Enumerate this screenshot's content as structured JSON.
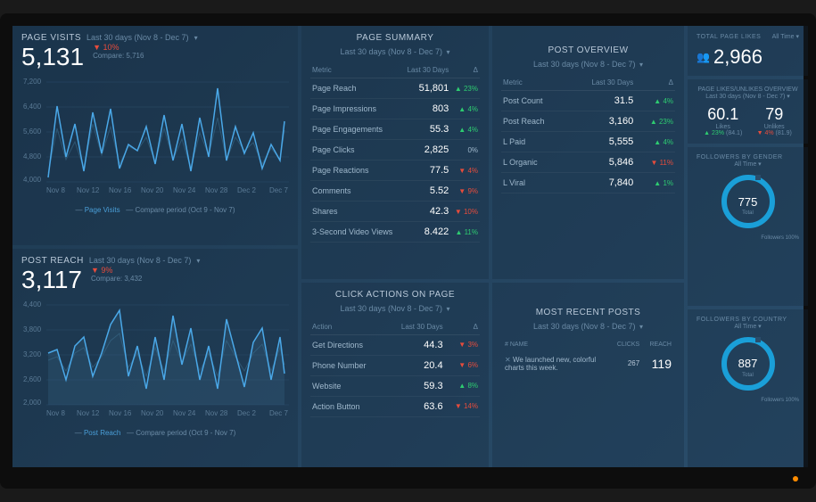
{
  "date_range_label": "Last 30 days (Nov 8 - Dec 7)",
  "compare_period": "Compare period (Oct 9 - Nov 7)",
  "page_visits": {
    "title": "PAGE VISITS",
    "value": "5,131",
    "delta": "10%",
    "compare": "Compare: 5,716",
    "legend": "Page Visits"
  },
  "post_reach": {
    "title": "POST REACH",
    "value": "3,117",
    "delta": "9%",
    "compare": "Compare: 3,432",
    "legend": "Post Reach"
  },
  "page_summary": {
    "title": "PAGE SUMMARY",
    "head_metric": "Metric",
    "head_val": "Last 30 Days",
    "head_delta": "Δ",
    "rows": [
      {
        "m": "Page Reach",
        "v": "51,801",
        "d": "▲ 23%",
        "c": "up"
      },
      {
        "m": "Page Impressions",
        "v": "803",
        "d": "▲ 4%",
        "c": "up"
      },
      {
        "m": "Page Engagements",
        "v": "55.3",
        "d": "▲ 4%",
        "c": "up"
      },
      {
        "m": "Page Clicks",
        "v": "2,825",
        "d": "0%",
        "c": ""
      },
      {
        "m": "Page Reactions",
        "v": "77.5",
        "d": "▼ 4%",
        "c": "down"
      },
      {
        "m": "Comments",
        "v": "5.52",
        "d": "▼ 9%",
        "c": "down"
      },
      {
        "m": "Shares",
        "v": "42.3",
        "d": "▼ 10%",
        "c": "down"
      },
      {
        "m": "3-Second Video Views",
        "v": "8.422",
        "d": "▲ 11%",
        "c": "up"
      }
    ]
  },
  "click_actions": {
    "title": "CLICK ACTIONS ON PAGE",
    "head_action": "Action",
    "head_val": "Last 30 Days",
    "head_delta": "Δ",
    "rows": [
      {
        "m": "Get Directions",
        "v": "44.3",
        "d": "▼ 3%",
        "c": "down"
      },
      {
        "m": "Phone Number",
        "v": "20.4",
        "d": "▼ 6%",
        "c": "down"
      },
      {
        "m": "Website",
        "v": "59.3",
        "d": "▲ 8%",
        "c": "up"
      },
      {
        "m": "Action Button",
        "v": "63.6",
        "d": "▼ 14%",
        "c": "down"
      }
    ]
  },
  "post_overview": {
    "title": "POST OVERVIEW",
    "head_metric": "Metric",
    "head_val": "Last 30 Days",
    "head_delta": "Δ",
    "rows": [
      {
        "m": "Post Count",
        "v": "31.5",
        "d": "▲ 4%",
        "c": "up"
      },
      {
        "m": "Post Reach",
        "v": "3,160",
        "d": "▲ 23%",
        "c": "up"
      },
      {
        "m": "L Paid",
        "v": "5,555",
        "d": "▲ 4%",
        "c": "up"
      },
      {
        "m": "L Organic",
        "v": "5,846",
        "d": "▼ 11%",
        "c": "down"
      },
      {
        "m": "L Viral",
        "v": "7,840",
        "d": "▲ 1%",
        "c": "up"
      }
    ]
  },
  "recent_posts": {
    "title": "MOST RECENT POSTS",
    "head_name": "NAME",
    "head_clicks": "CLICKS",
    "head_reach": "REACH",
    "row": {
      "name": "We launched new, colorful charts this week.",
      "clicks": "267",
      "reach": "119"
    }
  },
  "total_likes": {
    "label": "TOTAL PAGE LIKES",
    "range": "All Time",
    "value": "2,966"
  },
  "likes_unlikes": {
    "label": "PAGE LIKES/UNLIKES OVERVIEW",
    "range": "Last 30 days (Nov 8 - Dec 7)",
    "likes": {
      "v": "60.1",
      "l": "Likes",
      "d": "▲ 23%",
      "s": "(84.1)"
    },
    "unlikes": {
      "v": "79",
      "l": "Unlikes",
      "d": "▼ 4%",
      "s": "(81.9)"
    }
  },
  "gender": {
    "label": "FOLLOWERS BY GENDER",
    "range": "All Time",
    "value": "775",
    "sub": "Total",
    "legend": "Followers  100%"
  },
  "country": {
    "label": "FOLLOWERS BY COUNTRY",
    "range": "All Time",
    "value": "887",
    "sub": "Total",
    "legend": "Followers  100%"
  },
  "chart_data": [
    {
      "type": "line",
      "title": "Page Visits",
      "xlabel": "",
      "ylabel": "",
      "categories": [
        "Nov 8",
        "Nov 12",
        "Nov 16",
        "Nov 20",
        "Nov 24",
        "Nov 28",
        "Dec 2",
        "Dec 7"
      ],
      "ylim": [
        4000,
        7200
      ],
      "yticks": [
        4000,
        4800,
        5600,
        6400,
        7200
      ],
      "series": [
        {
          "name": "Page Visits",
          "values": [
            4100,
            6300,
            4700,
            5800,
            4300,
            6100,
            4800,
            6200,
            4400,
            5100,
            4900,
            5700,
            4500,
            6000,
            4600,
            5800,
            4300,
            5900,
            4700,
            6900,
            4600,
            5700,
            4800,
            5500,
            4400,
            5200,
            4600,
            6300,
            4500,
            5800
          ]
        },
        {
          "name": "Compare period",
          "values": [
            4200,
            5500,
            4800,
            5300,
            4500,
            5700,
            4900,
            5600,
            4600,
            5200,
            5000,
            5400,
            4700,
            5500,
            4800,
            5300,
            4500,
            5400,
            4900,
            5900,
            4800,
            5300,
            5000,
            5200,
            4600,
            5000,
            4800,
            5500,
            4700,
            5300
          ]
        }
      ]
    },
    {
      "type": "line",
      "title": "Post Reach",
      "xlabel": "",
      "ylabel": "",
      "categories": [
        "Nov 8",
        "Nov 12",
        "Nov 16",
        "Nov 20",
        "Nov 24",
        "Nov 28",
        "Dec 2",
        "Dec 7"
      ],
      "ylim": [
        2000,
        4400
      ],
      "yticks": [
        2000,
        2600,
        3200,
        3800,
        4400
      ],
      "series": [
        {
          "name": "Post Reach",
          "values": [
            3300,
            3400,
            2600,
            3500,
            3700,
            2700,
            3300,
            4000,
            4300,
            2700,
            3500,
            2400,
            3700,
            2600,
            4200,
            3000,
            3900,
            2600,
            3500,
            2400,
            4100,
            3300,
            2500,
            3600,
            3900,
            2600,
            3700,
            2200,
            3500,
            2800
          ]
        },
        {
          "name": "Compare period",
          "values": [
            3100,
            3200,
            2800,
            3300,
            3400,
            2900,
            3200,
            3600,
            3700,
            2900,
            3300,
            2700,
            3400,
            2800,
            3600,
            3100,
            3500,
            2800,
            3300,
            2700,
            3600,
            3200,
            2800,
            3300,
            3500,
            2800,
            3400,
            2600,
            3300,
            3000
          ]
        }
      ]
    }
  ]
}
